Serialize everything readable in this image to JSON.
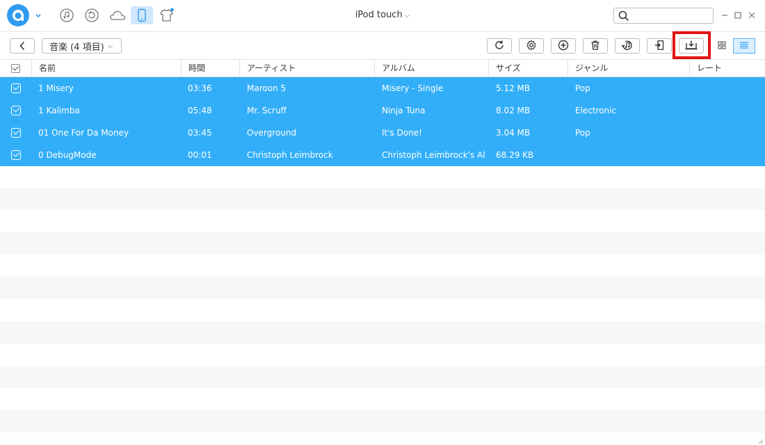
{
  "titlebar": {
    "device_name": "iPod touch",
    "search": {
      "value": "",
      "placeholder": ""
    },
    "nav_icons": [
      "music-library-icon",
      "restore-icon",
      "icloud-icon",
      "device-icon",
      "shirt-icon"
    ]
  },
  "toolbar": {
    "category_label": "音楽 (4 項目)",
    "buttons": [
      "refresh-icon",
      "settings-icon",
      "add-icon",
      "delete-icon",
      "to-itunes-icon",
      "export-icon",
      "to-computer-icon"
    ],
    "highlighted_button": "to-computer-icon",
    "highlight_color": "#e21313"
  },
  "table": {
    "columns": [
      "名前",
      "時間",
      "アーティスト",
      "アルバム",
      "サイズ",
      "ジャンル",
      "レート"
    ],
    "rows": [
      {
        "name": "1 Misery",
        "time": "03:36",
        "artist": "Maroon 5",
        "album": "Misery - Single",
        "size": "5.12 MB",
        "genre": "Pop",
        "rate": ""
      },
      {
        "name": "1 Kalimba",
        "time": "05:48",
        "artist": "Mr. Scruff",
        "album": "Ninja Tuna",
        "size": "8.02 MB",
        "genre": "Electronic",
        "rate": ""
      },
      {
        "name": "01 One For Da Money",
        "time": "03:45",
        "artist": "Overground",
        "album": "It's Done!",
        "size": "3.04 MB",
        "genre": "Pop",
        "rate": ""
      },
      {
        "name": "0 DebugMode",
        "time": "00:01",
        "artist": "Christoph Leimbrock",
        "album": "Christoph Leimbrock's Al...",
        "size": "68.29 KB",
        "genre": "",
        "rate": ""
      }
    ],
    "selected_color": "#32aef8"
  },
  "colors": {
    "accent": "#2f9bf0",
    "selection": "#32aef8",
    "highlight": "#e21313"
  }
}
